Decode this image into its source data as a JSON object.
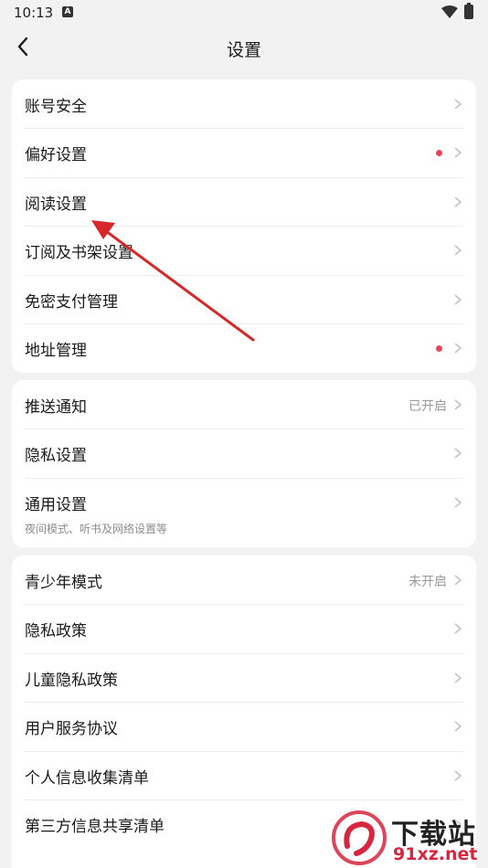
{
  "status_bar": {
    "time": "10:13",
    "notification_letter": "A"
  },
  "header": {
    "title": "设置"
  },
  "group1": [
    {
      "label": "账号安全"
    },
    {
      "label": "偏好设置",
      "dot": true
    },
    {
      "label": "阅读设置"
    },
    {
      "label": "订阅及书架设置"
    },
    {
      "label": "免密支付管理"
    },
    {
      "label": "地址管理",
      "dot": true
    }
  ],
  "group2": [
    {
      "label": "推送通知",
      "status": "已开启"
    },
    {
      "label": "隐私设置"
    },
    {
      "label": "通用设置",
      "sub": "夜间模式、听书及网络设置等"
    }
  ],
  "group3": [
    {
      "label": "青少年模式",
      "status": "未开启"
    },
    {
      "label": "隐私政策"
    },
    {
      "label": "儿童隐私政策"
    },
    {
      "label": "用户服务协议"
    },
    {
      "label": "个人信息收集清单"
    },
    {
      "label": "第三方信息共享清单"
    }
  ],
  "watermark": {
    "text": "下载站",
    "url": "91xz.net"
  },
  "colors": {
    "dot": "#f0405a",
    "annotation_arrow": "#d62828",
    "background": "#f2f2f2"
  }
}
